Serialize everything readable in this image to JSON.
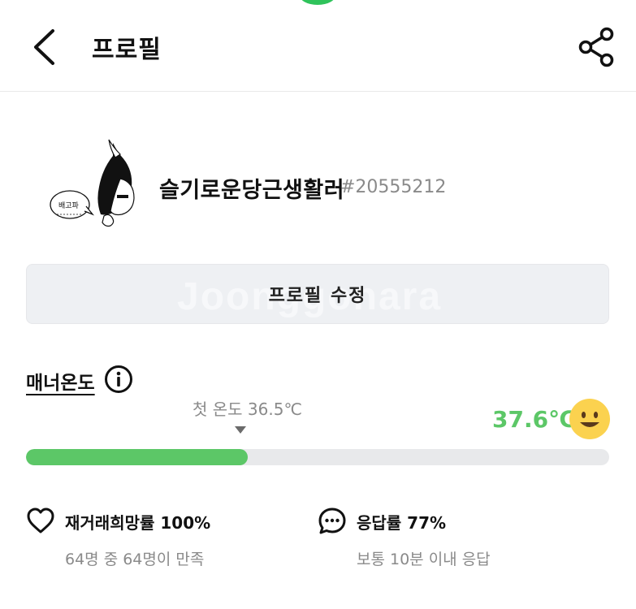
{
  "header": {
    "title": "프로필",
    "back_icon": "chevron-left-icon",
    "share_icon": "share-icon"
  },
  "profile": {
    "nickname": "슬기로운당근생활러",
    "user_id": "#20555212",
    "avatar_caption": "배고파"
  },
  "edit_button": {
    "label": "프로필 수정",
    "watermark": "Joonggonara"
  },
  "manner": {
    "title": "매너온도",
    "first_temp_label": "첫 온도 36.5℃",
    "temperature": "37.6℃",
    "progress": 0.38,
    "color": "#5cc767"
  },
  "stats": {
    "repurchase": {
      "label": "재거래희망률 100%",
      "sub": "64명 중 64명이 만족",
      "icon": "heart-icon"
    },
    "response": {
      "label": "응답률 77%",
      "sub": "보통 10분 이내 응답",
      "icon": "chat-bubble-icon"
    }
  }
}
